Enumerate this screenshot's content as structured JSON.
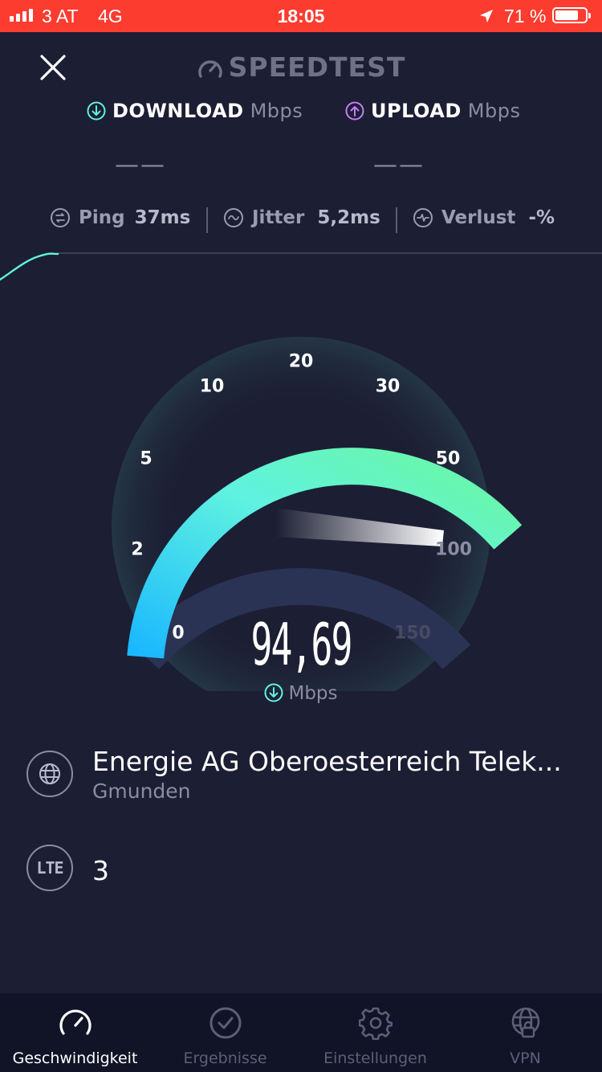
{
  "status_bar": {
    "carrier": "3 AT",
    "network": "4G",
    "time": "18:05",
    "battery": "71 %"
  },
  "app": {
    "title": "SPEEDTEST"
  },
  "download": {
    "label": "DOWNLOAD",
    "unit": "Mbps",
    "value": "——"
  },
  "upload": {
    "label": "UPLOAD",
    "unit": "Mbps",
    "value": "——"
  },
  "metrics": {
    "ping_label": "Ping",
    "ping_value": "37",
    "ping_unit": "ms",
    "jitter_label": "Jitter",
    "jitter_value": "5,2",
    "jitter_unit": "ms",
    "loss_label": "Verlust",
    "loss_value": "-%"
  },
  "gauge": {
    "ticks": [
      "0",
      "2",
      "5",
      "10",
      "20",
      "30",
      "50",
      "100",
      "150"
    ],
    "current_value": "94,69",
    "unit": "Mbps",
    "colors": {
      "start": "#1ab8ff",
      "mid": "#5ff2e0",
      "end": "#6bf7a2",
      "track": "#2a3354"
    }
  },
  "server": {
    "isp": "Energie AG Oberoesterreich Telek...",
    "location": "Gmunden"
  },
  "connection": {
    "badge": "LTE",
    "carrier": "3"
  },
  "tabs": [
    {
      "label": "Geschwindigkeit",
      "icon": "speedometer-icon",
      "active": true
    },
    {
      "label": "Ergebnisse",
      "icon": "checkmark-circle-icon",
      "active": false
    },
    {
      "label": "Einstellungen",
      "icon": "gear-icon",
      "active": false
    },
    {
      "label": "VPN",
      "icon": "vpn-globe-lock-icon",
      "active": false
    }
  ]
}
